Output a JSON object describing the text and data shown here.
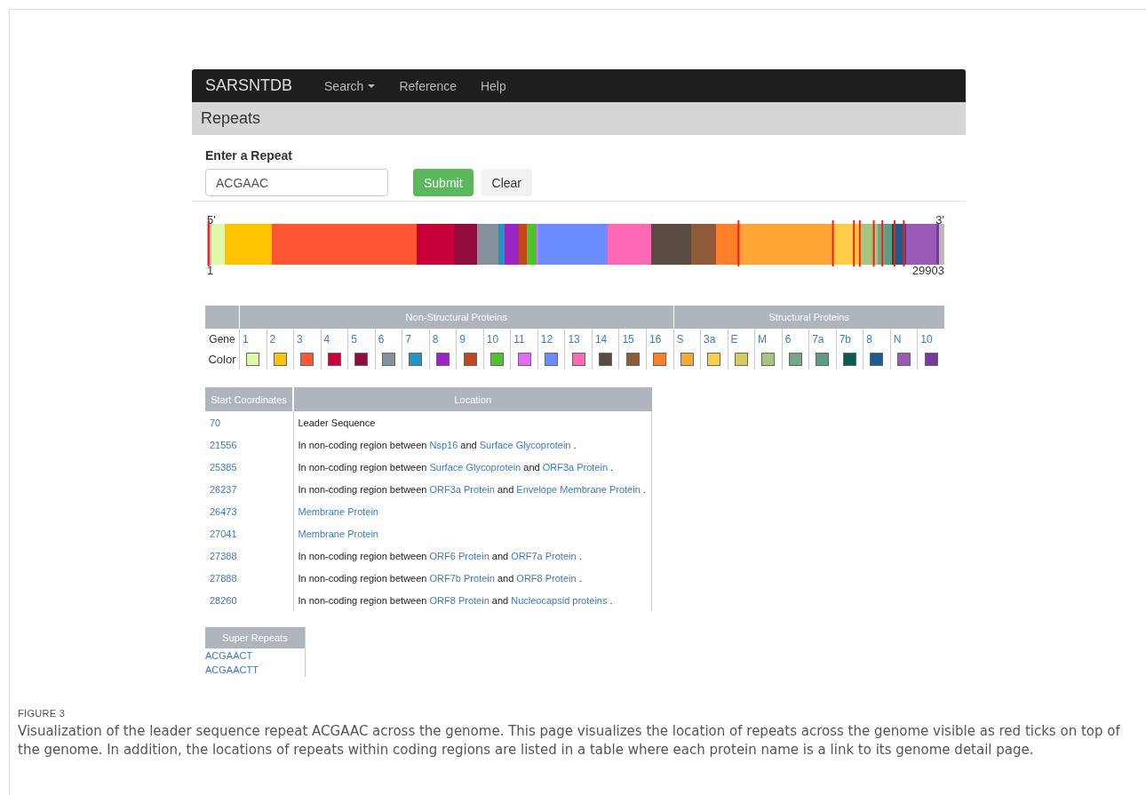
{
  "navbar": {
    "brand": "SARSNTDB",
    "items": [
      {
        "label": "Search",
        "dropdown": true
      },
      {
        "label": "Reference",
        "dropdown": false
      },
      {
        "label": "Help",
        "dropdown": false
      }
    ]
  },
  "page_header": "Repeats",
  "form": {
    "label": "Enter a Repeat",
    "value": "ACGAAC",
    "buttons": [
      {
        "label": "Submit",
        "kind": "primary"
      },
      {
        "label": "Clear",
        "kind": "default"
      }
    ]
  },
  "genome": {
    "five_prime": "5'",
    "three_prime": "3'",
    "start": "1",
    "end": "29903"
  },
  "legend": {
    "groups": [
      {
        "label": "Non-Structural Proteins"
      },
      {
        "label": "Structural Proteins"
      }
    ],
    "gene_label": "Gene",
    "color_label": "Color",
    "genes": [
      {
        "name": "1",
        "color": "#e0f8a8"
      },
      {
        "name": "2",
        "color": "#ffc300"
      },
      {
        "name": "3",
        "color": "#ff5733"
      },
      {
        "name": "4",
        "color": "#c70039"
      },
      {
        "name": "5",
        "color": "#900c3f"
      },
      {
        "name": "6",
        "color": "#85929e"
      },
      {
        "name": "7",
        "color": "#2196c6"
      },
      {
        "name": "8",
        "color": "#9b24c4"
      },
      {
        "name": "9",
        "color": "#c2461c"
      },
      {
        "name": "10",
        "color": "#4cc42a"
      },
      {
        "name": "11",
        "color": "#e06cf7"
      },
      {
        "name": "12",
        "color": "#6a8cff"
      },
      {
        "name": "13",
        "color": "#ff69b4"
      },
      {
        "name": "14",
        "color": "#574b42"
      },
      {
        "name": "15",
        "color": "#8d5a3a"
      },
      {
        "name": "16",
        "color": "#ff7f2a"
      },
      {
        "name": "S",
        "color": "#ffa535"
      },
      {
        "name": "3a",
        "color": "#ffcd45"
      },
      {
        "name": "E",
        "color": "#d4cb64"
      },
      {
        "name": "M",
        "color": "#a3c57e"
      },
      {
        "name": "6",
        "color": "#72a88a"
      },
      {
        "name": "7a",
        "color": "#5c9c85"
      },
      {
        "name": "7b",
        "color": "#0a5c4c"
      },
      {
        "name": "8",
        "color": "#1f5a8c"
      },
      {
        "name": "N",
        "color": "#9b59b6"
      },
      {
        "name": "10",
        "color": "#7a3a9c"
      }
    ]
  },
  "results": {
    "columns": [
      "Start Coordinates",
      "Location"
    ],
    "rows": [
      {
        "start": "70",
        "location": [
          {
            "kind": "text",
            "text": "Leader Sequence"
          }
        ]
      },
      {
        "start": "21556",
        "location": [
          {
            "kind": "text",
            "text": "In non-coding region between "
          },
          {
            "kind": "link",
            "text": "Nsp16"
          },
          {
            "kind": "text",
            "text": " and "
          },
          {
            "kind": "link",
            "text": "Surface Glycoprotein"
          },
          {
            "kind": "text",
            "text": " ."
          }
        ]
      },
      {
        "start": "25385",
        "location": [
          {
            "kind": "text",
            "text": "In non-coding region between "
          },
          {
            "kind": "link",
            "text": "Surface Glycoprotein"
          },
          {
            "kind": "text",
            "text": " and "
          },
          {
            "kind": "link",
            "text": "ORF3a Protein"
          },
          {
            "kind": "text",
            "text": " ."
          }
        ]
      },
      {
        "start": "26237",
        "location": [
          {
            "kind": "text",
            "text": "In non-coding region between "
          },
          {
            "kind": "link",
            "text": "ORF3a Protein"
          },
          {
            "kind": "text",
            "text": " and "
          },
          {
            "kind": "link",
            "text": "Envelope Membrane Protein"
          },
          {
            "kind": "text",
            "text": " ."
          }
        ]
      },
      {
        "start": "26473",
        "location": [
          {
            "kind": "link",
            "text": "Membrane Protein"
          }
        ]
      },
      {
        "start": "27041",
        "location": [
          {
            "kind": "link",
            "text": "Membrane Protein"
          }
        ]
      },
      {
        "start": "27388",
        "location": [
          {
            "kind": "text",
            "text": "In non-coding region between "
          },
          {
            "kind": "link",
            "text": "ORF6 Protein"
          },
          {
            "kind": "text",
            "text": " and "
          },
          {
            "kind": "link",
            "text": "ORF7a Protein"
          },
          {
            "kind": "text",
            "text": " ."
          }
        ]
      },
      {
        "start": "27888",
        "location": [
          {
            "kind": "text",
            "text": "In non-coding region between "
          },
          {
            "kind": "link",
            "text": "ORF7b Protein"
          },
          {
            "kind": "text",
            "text": " and "
          },
          {
            "kind": "link",
            "text": "ORF8 Protein"
          },
          {
            "kind": "text",
            "text": " ."
          }
        ]
      },
      {
        "start": "28260",
        "location": [
          {
            "kind": "text",
            "text": "In non-coding region between "
          },
          {
            "kind": "link",
            "text": "ORF8 Protein"
          },
          {
            "kind": "text",
            "text": " and "
          },
          {
            "kind": "link",
            "text": "Nucleocapsid proteins"
          },
          {
            "kind": "text",
            "text": " ."
          }
        ]
      }
    ]
  },
  "super_repeats": {
    "title": "Super Repeats",
    "items": [
      "ACGAACT",
      "ACGAACTT"
    ]
  },
  "caption": {
    "label": "FIGURE 3",
    "text": "Visualization of the leader sequence repeat ACGAAC across the genome. This page visualizes the location of repeats across the genome visible as red ticks on top of the genome. In addition, the locations of repeats within coding regions are listed in a table where each protein name is a link to its genome detail page."
  }
}
